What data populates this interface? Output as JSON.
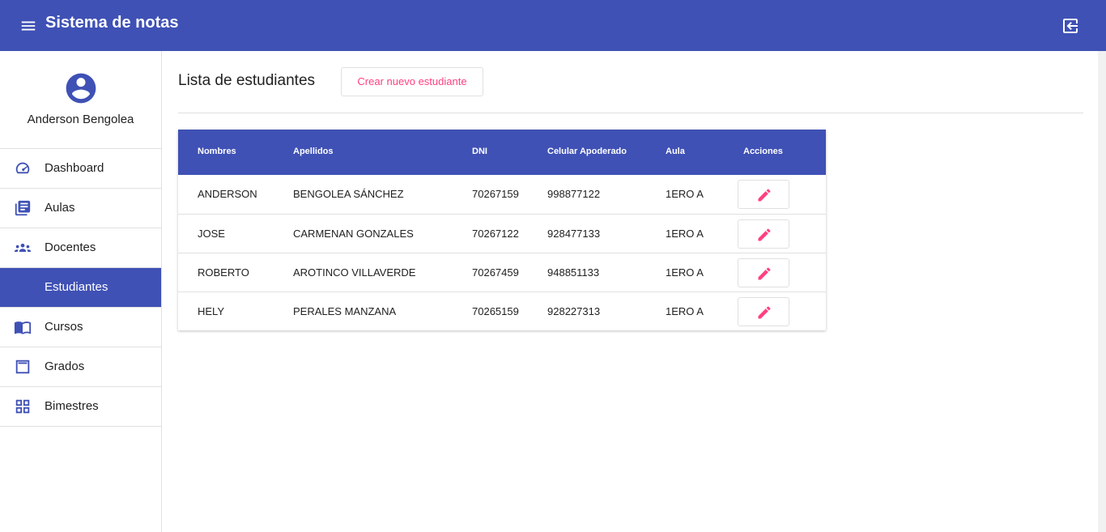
{
  "header": {
    "title": "Sistema de notas"
  },
  "sidebar": {
    "user_name": "Anderson Bengolea",
    "items": [
      {
        "label": "Dashboard",
        "icon": "speedometer-icon",
        "active": false
      },
      {
        "label": "Aulas",
        "icon": "library-books-icon",
        "active": false
      },
      {
        "label": "Docentes",
        "icon": "people-icon",
        "active": false
      },
      {
        "label": "Estudiantes",
        "icon": "",
        "active": true
      },
      {
        "label": "Cursos",
        "icon": "open-book-icon",
        "active": false
      },
      {
        "label": "Grados",
        "icon": "window-icon",
        "active": false
      },
      {
        "label": "Bimestres",
        "icon": "grid-icon",
        "active": false
      }
    ]
  },
  "main": {
    "title": "Lista de estudiantes",
    "create_button": "Crear nuevo estudiante",
    "table": {
      "headers": [
        "Nombres",
        "Apellidos",
        "DNI",
        "Celular Apoderado",
        "Aula",
        "Acciones"
      ],
      "rows": [
        {
          "nombres": "ANDERSON",
          "apellidos": "BENGOLEA SÁNCHEZ",
          "dni": "70267159",
          "celular": "998877122",
          "aula": "1ERO A"
        },
        {
          "nombres": "JOSE",
          "apellidos": "CARMENAN GONZALES",
          "dni": "70267122",
          "celular": "928477133",
          "aula": "1ERO A"
        },
        {
          "nombres": "ROBERTO",
          "apellidos": "AROTINCO VILLAVERDE",
          "dni": "70267459",
          "celular": "948851133",
          "aula": "1ERO A"
        },
        {
          "nombres": "HELY",
          "apellidos": "PERALES MANZANA",
          "dni": "70265159",
          "celular": "928227313",
          "aula": "1ERO A"
        }
      ]
    }
  },
  "colors": {
    "primary": "#3f51b5",
    "accent": "#ff4081"
  }
}
